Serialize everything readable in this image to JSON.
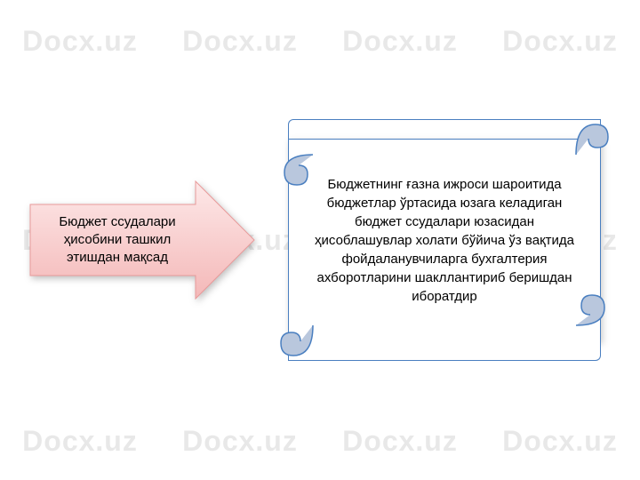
{
  "watermark": "Docx.uz",
  "arrow": {
    "text": "Бюджет ссудалари ҳисобини ташкил этишдан мақсад",
    "fillTop": "#fde8e8",
    "fillBottom": "#f4b8b8",
    "stroke": "#e89a9a"
  },
  "scroll": {
    "text": "Бюджетнинг ғазна ижроси шароитида бюджетлар ўртасида юзага келадиган бюджет ссудалари юзасидан ҳисоблашувлар холати бўйича ўз вақтида фойдаланувчиларга бухгалтерия ахборотларини шакллантириб беришдан иборатдир",
    "stroke": "#4a7fc0",
    "curlFill": "#b9c7dd"
  }
}
